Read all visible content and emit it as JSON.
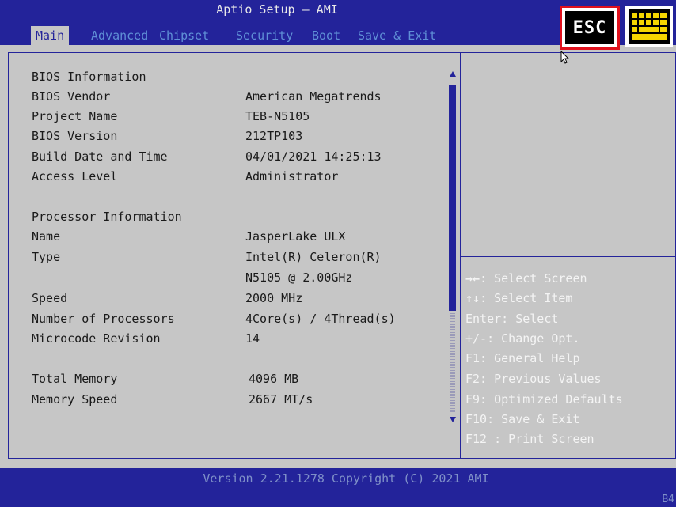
{
  "window": {
    "title": "Aptio Setup – AMI"
  },
  "tabs": [
    {
      "label": "Main",
      "active": true
    },
    {
      "label": "Advanced"
    },
    {
      "label": "Chipset"
    },
    {
      "label": "Security"
    },
    {
      "label": "Boot"
    },
    {
      "label": "Save & Exit"
    }
  ],
  "toolbar": {
    "esc_label": "ESC",
    "keyboard_icon": "keyboard-icon"
  },
  "info": {
    "bios_header": "BIOS Information",
    "vendor_label": "BIOS Vendor",
    "vendor_value": "American Megatrends",
    "project_label": "Project Name",
    "project_value": "TEB-N5105",
    "version_label": "BIOS Version",
    "version_value": "212TP103",
    "build_label": "Build Date and Time",
    "build_value": "04/01/2021 14:25:13",
    "access_label": "Access Level",
    "access_value": "Administrator",
    "proc_header": "Processor Information",
    "name_label": "Name",
    "name_value": "JasperLake ULX",
    "type_label": "Type",
    "type_value_1": "Intel(R) Celeron(R)",
    "type_value_2": "N5105 @ 2.00GHz",
    "speed_label": "Speed",
    "speed_value": "2000 MHz",
    "nproc_label": "Number of Processors",
    "nproc_value": "4Core(s) / 4Thread(s)",
    "micro_label": "Microcode Revision",
    "micro_value": "14",
    "mem_label": "Total Memory",
    "mem_value": "4096 MB",
    "memspeed_label": "Memory Speed",
    "memspeed_value": "2667 MT/s"
  },
  "help": [
    {
      "key": "→←",
      "text": ": Select Screen"
    },
    {
      "key": "↑↓",
      "text": ": Select Item"
    },
    {
      "key": "",
      "text": "Enter: Select"
    },
    {
      "key": "",
      "text": "+/-: Change Opt."
    },
    {
      "key": "",
      "text": "F1: General Help"
    },
    {
      "key": "",
      "text": "F2: Previous Values"
    },
    {
      "key": "",
      "text": "F9: Optimized Defaults"
    },
    {
      "key": "",
      "text": "F10: Save & Exit"
    },
    {
      "key": "",
      "text": "F12 : Print Screen"
    }
  ],
  "footer": {
    "version": "Version 2.21.1278 Copyright (C) 2021 AMI",
    "corner": "B4"
  },
  "colors": {
    "header_bg": "#23239a",
    "panel_bg": "#c6c6c6",
    "highlight": "#e0101c"
  }
}
